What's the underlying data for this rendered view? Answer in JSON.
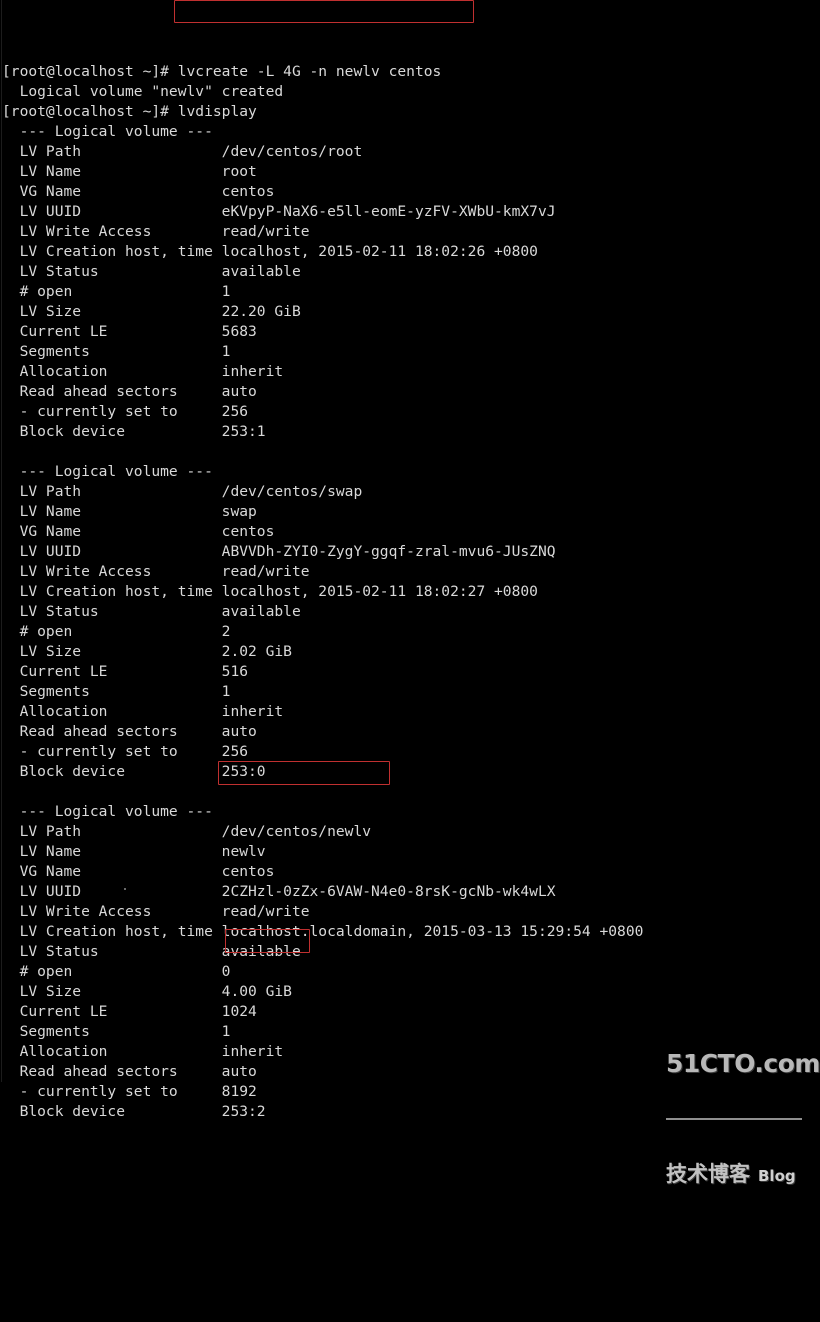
{
  "terminal": {
    "prompt": "[root@localhost ~]#",
    "lines": [
      "[root@localhost ~]# lvcreate -L 4G -n newlv centos",
      "  Logical volume \"newlv\" created",
      "[root@localhost ~]# lvdisplay",
      "  --- Logical volume ---",
      "  LV Path                /dev/centos/root",
      "  LV Name                root",
      "  VG Name                centos",
      "  LV UUID                eKVpyP-NaX6-e5ll-eomE-yzFV-XWbU-kmX7vJ",
      "  LV Write Access        read/write",
      "  LV Creation host, time localhost, 2015-02-11 18:02:26 +0800",
      "  LV Status              available",
      "  # open                 1",
      "  LV Size                22.20 GiB",
      "  Current LE             5683",
      "  Segments               1",
      "  Allocation             inherit",
      "  Read ahead sectors     auto",
      "  - currently set to     256",
      "  Block device           253:1",
      "",
      "  --- Logical volume ---",
      "  LV Path                /dev/centos/swap",
      "  LV Name                swap",
      "  VG Name                centos",
      "  LV UUID                ABVVDh-ZYI0-ZygY-ggqf-zral-mvu6-JUsZNQ",
      "  LV Write Access        read/write",
      "  LV Creation host, time localhost, 2015-02-11 18:02:27 +0800",
      "  LV Status              available",
      "  # open                 2",
      "  LV Size                2.02 GiB",
      "  Current LE             516",
      "  Segments               1",
      "  Allocation             inherit",
      "  Read ahead sectors     auto",
      "  - currently set to     256",
      "  Block device           253:0",
      "",
      "  --- Logical volume ---",
      "  LV Path                /dev/centos/newlv",
      "  LV Name                newlv",
      "  VG Name                centos",
      "  LV UUID                2CZHzl-0zZx-6VAW-N4e0-8rsK-gcNb-wk4wLX",
      "  LV Write Access        read/write",
      "  LV Creation host, time localhost.localdomain, 2015-03-13 15:29:54 +0800",
      "  LV Status              available",
      "  # open                 0",
      "  LV Size                4.00 GiB",
      "  Current LE             1024",
      "  Segments               1",
      "  Allocation             inherit",
      "  Read ahead sectors     auto",
      "  - currently set to     8192",
      "  Block device           253:2"
    ],
    "commands": [
      "lvcreate -L 4G -n newlv centos",
      "lvdisplay"
    ],
    "highlights": [
      {
        "name": "lvcreate-command",
        "text": "lvcreate -L 4G -n newlv centos",
        "color": "#c03030"
      },
      {
        "name": "lv-path-newlv",
        "text": "/dev/centos/newlv",
        "color": "#c03030"
      },
      {
        "name": "lv-size-newlv",
        "text": "4.00 GiB",
        "color": "#c03030"
      }
    ],
    "volumes": [
      {
        "header": "--- Logical volume ---",
        "lv_path": "/dev/centos/root",
        "lv_name": "root",
        "vg_name": "centos",
        "lv_uuid": "eKVpyP-NaX6-e5ll-eomE-yzFV-XWbU-kmX7vJ",
        "lv_write_access": "read/write",
        "lv_creation_host_time": "localhost, 2015-02-11 18:02:26 +0800",
        "lv_status": "available",
        "open_count": "1",
        "lv_size": "22.20 GiB",
        "current_le": "5683",
        "segments": "1",
        "allocation": "inherit",
        "read_ahead_sectors": "auto",
        "currently_set_to": "256",
        "block_device": "253:1"
      },
      {
        "header": "--- Logical volume ---",
        "lv_path": "/dev/centos/swap",
        "lv_name": "swap",
        "vg_name": "centos",
        "lv_uuid": "ABVVDh-ZYI0-ZygY-ggqf-zral-mvu6-JUsZNQ",
        "lv_write_access": "read/write",
        "lv_creation_host_time": "localhost, 2015-02-11 18:02:27 +0800",
        "lv_status": "available",
        "open_count": "2",
        "lv_size": "2.02 GiB",
        "current_le": "516",
        "segments": "1",
        "allocation": "inherit",
        "read_ahead_sectors": "auto",
        "currently_set_to": "256",
        "block_device": "253:0"
      },
      {
        "header": "--- Logical volume ---",
        "lv_path": "/dev/centos/newlv",
        "lv_name": "newlv",
        "vg_name": "centos",
        "lv_uuid": "2CZHzl-0zZx-6VAW-N4e0-8rsK-gcNb-wk4wLX",
        "lv_write_access": "read/write",
        "lv_creation_host_time": "localhost.localdomain, 2015-03-13 15:29:54 +0800",
        "lv_status": "available",
        "open_count": "0",
        "lv_size": "4.00 GiB",
        "current_le": "1024",
        "segments": "1",
        "allocation": "inherit",
        "read_ahead_sectors": "auto",
        "currently_set_to": "8192",
        "block_device": "253:2"
      }
    ],
    "labels": {
      "lv_path": "LV Path",
      "lv_name": "LV Name",
      "vg_name": "VG Name",
      "lv_uuid": "LV UUID",
      "lv_write_access": "LV Write Access",
      "lv_creation_host_time": "LV Creation host, time",
      "lv_status": "LV Status",
      "open_count": "# open",
      "lv_size": "LV Size",
      "current_le": "Current LE",
      "segments": "Segments",
      "allocation": "Allocation",
      "read_ahead_sectors": "Read ahead sectors",
      "currently_set_to": "- currently set to",
      "block_device": "Block device"
    },
    "output_messages": [
      "  Logical volume \"newlv\" created"
    ]
  },
  "watermark": {
    "main": "51CTO.com",
    "sub": "技术博客",
    "blog": "Blog"
  },
  "colors": {
    "background": "#000000",
    "foreground": "#d9d9d9",
    "highlight_box": "#c03030"
  }
}
